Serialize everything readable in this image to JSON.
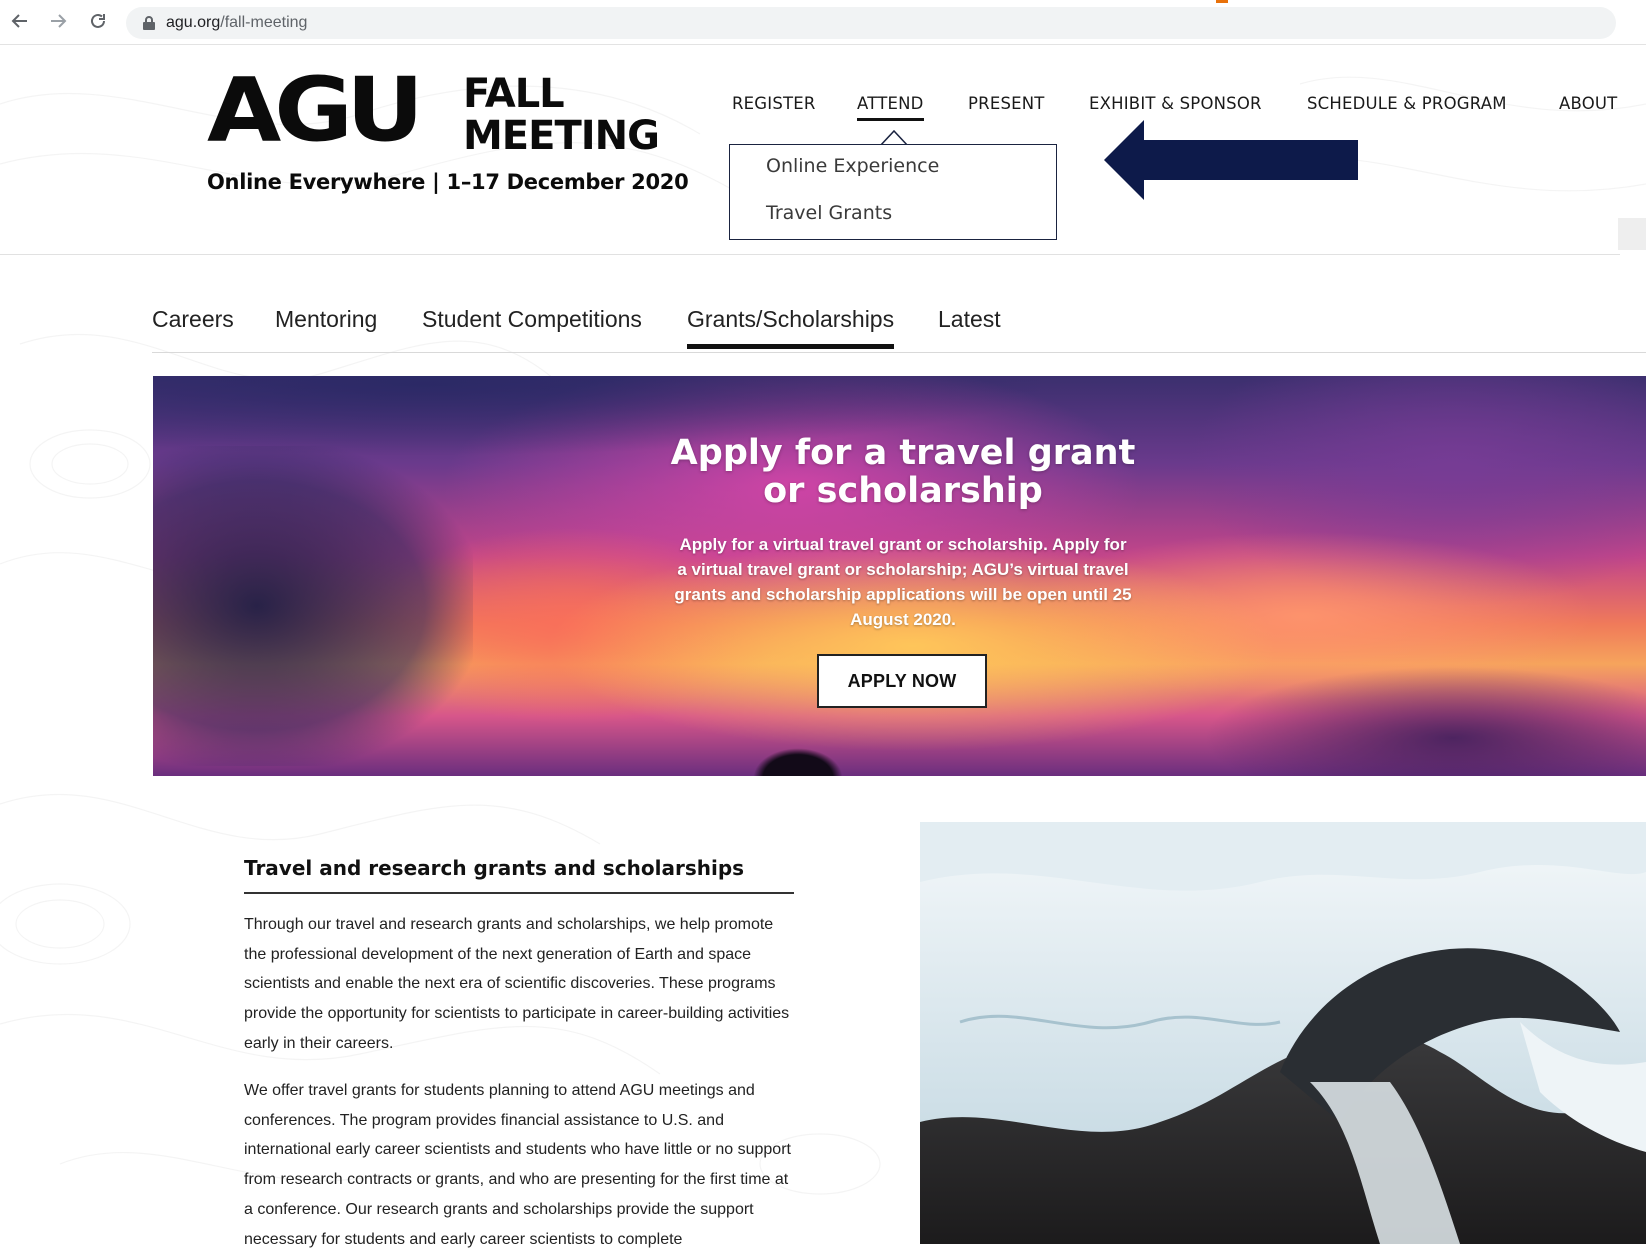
{
  "browser": {
    "url_host": "agu.org",
    "url_path": "/fall-meeting"
  },
  "header": {
    "logo": {
      "agu": "AGU",
      "fall": "FALL",
      "meeting": "MEETING",
      "tagline": "Online Everywhere | 1–17 December 2020"
    },
    "nav": [
      {
        "label": "REGISTER",
        "active": false
      },
      {
        "label": "ATTEND",
        "active": true
      },
      {
        "label": "PRESENT",
        "active": false
      },
      {
        "label": "EXHIBIT & SPONSOR",
        "active": false
      },
      {
        "label": "SCHEDULE & PROGRAM",
        "active": false
      },
      {
        "label": "ABOUT",
        "active": false
      }
    ],
    "dropdown": [
      "Online Experience",
      "Travel Grants"
    ]
  },
  "subnav": [
    {
      "label": "Careers",
      "active": false
    },
    {
      "label": "Mentoring",
      "active": false
    },
    {
      "label": "Student Competitions",
      "active": false
    },
    {
      "label": "Grants/Scholarships",
      "active": true
    },
    {
      "label": "Latest",
      "active": false
    }
  ],
  "hero": {
    "title": "Apply for a travel grant or scholarship",
    "body": "Apply for a virtual travel grant or scholarship. Apply for a virtual travel grant or scholarship; AGU’s virtual travel grants and scholarship applications will be open until 25 August 2020.",
    "button": "APPLY NOW"
  },
  "content": {
    "title": "Travel and research grants and scholarships",
    "para1": "Through our travel and research grants and scholarships, we help promote the professional development of the next generation of Earth and space scientists and enable the next era of scientific discoveries. These programs provide the opportunity for scientists to participate in career-building activities early in their careers.",
    "para2": "We offer travel grants for students planning to attend AGU meetings and conferences. The program provides financial assistance to U.S. and international early career scientists and students who have little or no support from research contracts or grants, and who are presenting for the first time at a conference. Our research grants and scholarships provide the support necessary for students and early career scientists to complete"
  },
  "colors": {
    "annotation_arrow": "#0d1a4a",
    "dropdown_border": "#1a2340"
  }
}
